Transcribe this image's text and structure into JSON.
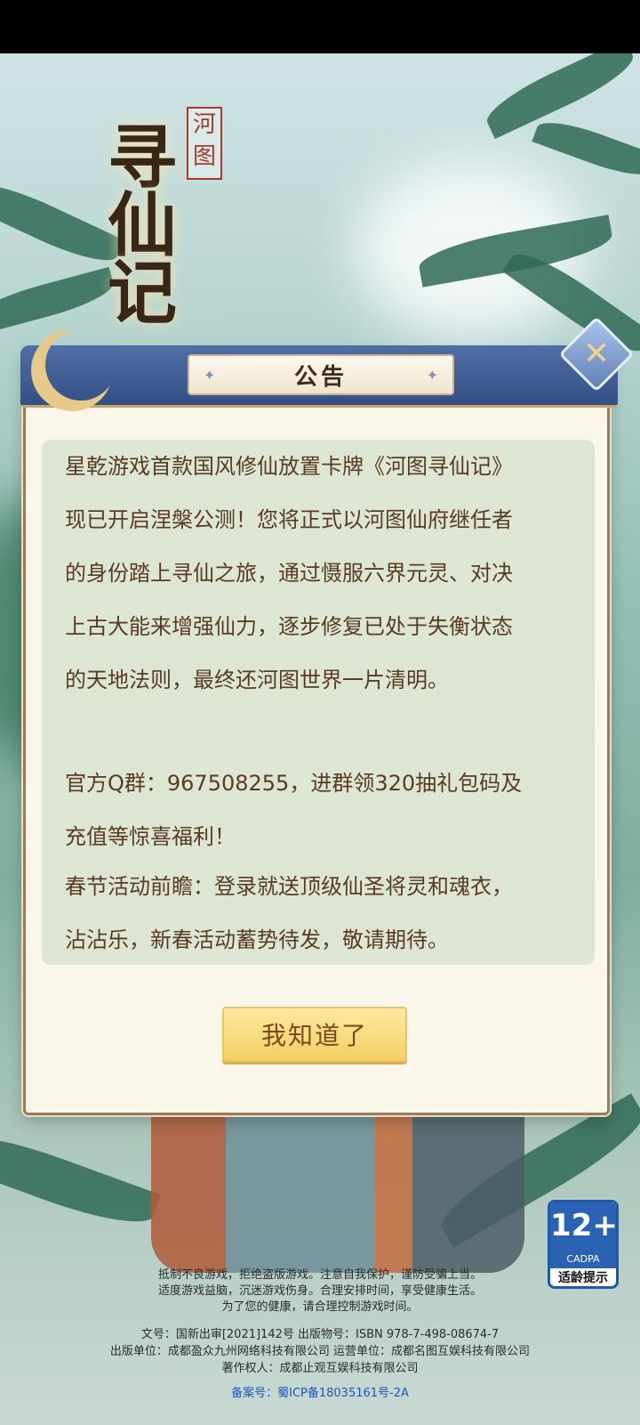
{
  "logo": {
    "seal": "河\n图",
    "title": "寻仙记"
  },
  "dialog": {
    "title": "公告",
    "close_icon": "✕",
    "paragraphs": [
      "星乾游戏首款国风修仙放置卡牌《河图寻仙记》",
      "现已开启涅槃公测！您将正式以河图仙府继任者",
      "的身份踏上寻仙之旅，通过慑服六界元灵、对决",
      "上古大能来增强仙力，逐步修复已处于失衡状态",
      "的天地法则，最终还河图世界一片清明。",
      "",
      "官方Q群：967508255，进群领320抽礼包码及",
      "充值等惊喜福利！",
      "春节活动前瞻：登录就送顶级仙圣将灵和魂衣，",
      "沾沾乐，新春活动蓄势待发，敬请期待。"
    ],
    "ok_button": "我知道了"
  },
  "age_rating": {
    "age": "12+",
    "org": "CADPA",
    "tip": "适龄提示"
  },
  "footer": {
    "line1": "抵制不良游戏，拒绝盗版游戏。注意自我保护，谨防受骗上当。",
    "line2": "适度游戏益脑，沉迷游戏伤身。合理安排时间，享受健康生活。",
    "line3": "为了您的健康，请合理控制游戏时间。",
    "line4": "文号：国新出审[2021]142号   出版物号：ISBN 978-7-498-08674-7",
    "line5": "出版单位：成都盈众九州网络科技有限公司   运营单位：成都名图互娱科技有限公司",
    "line6": "著作权人：成都止观互娱科技有限公司",
    "icp": "备案号：蜀ICP备18035161号-2A"
  }
}
